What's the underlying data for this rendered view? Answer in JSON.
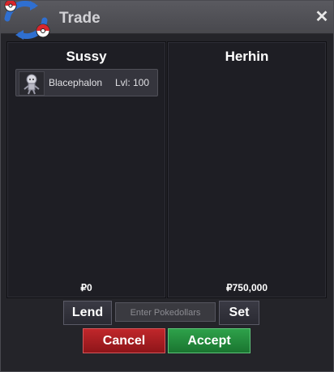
{
  "window": {
    "title": "Trade",
    "close_icon": "close-icon",
    "logo_icon": "pokeball-swap-logo"
  },
  "left_panel": {
    "player_name": "Sussy",
    "items": [
      {
        "icon": "pokemon-sprite-icon",
        "name": "Blacephalon",
        "level": "Lvl: 100"
      }
    ],
    "money": "₽0"
  },
  "right_panel": {
    "player_name": "Herhin",
    "items": [],
    "money": "₽750,000"
  },
  "controls": {
    "lend_label": "Lend",
    "amount_placeholder": "Enter Pokedollars",
    "amount_value": "",
    "set_label": "Set",
    "cancel_label": "Cancel",
    "accept_label": "Accept"
  },
  "colors": {
    "cancel": "#b02328",
    "accept": "#27923f",
    "logo_blue": "#2f6fd0",
    "logo_red": "#d8262c"
  }
}
